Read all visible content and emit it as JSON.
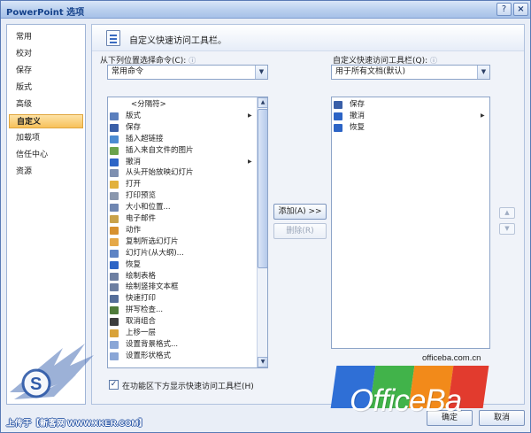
{
  "window": {
    "title": "PowerPoint 选项",
    "help_glyph": "?",
    "close_glyph": "×"
  },
  "sidebar": {
    "items": [
      {
        "label": "常用"
      },
      {
        "label": "校对"
      },
      {
        "label": "保存"
      },
      {
        "label": "版式"
      },
      {
        "label": "高级"
      },
      {
        "label": "自定义",
        "active": true
      },
      {
        "label": "加载项"
      },
      {
        "label": "信任中心"
      },
      {
        "label": "资源"
      }
    ]
  },
  "header": {
    "title": "自定义快速访问工具栏。",
    "icon": "toolbar-icon"
  },
  "left_panel": {
    "choose_label": "从下列位置选择命令(C):",
    "info_glyph": "ⓘ",
    "choose_value": "常用命令",
    "commands": [
      {
        "label": "<分隔符>",
        "icon": "none",
        "separator": true
      },
      {
        "label": "版式",
        "icon": "layout-icon",
        "submenu": true
      },
      {
        "label": "保存",
        "icon": "save-icon"
      },
      {
        "label": "插入超链接",
        "icon": "hyperlink-icon"
      },
      {
        "label": "插入来自文件的图片",
        "icon": "picture-icon"
      },
      {
        "label": "撤消",
        "icon": "undo-icon",
        "submenu": true
      },
      {
        "label": "从头开始放映幻灯片",
        "icon": "slideshow-icon"
      },
      {
        "label": "打开",
        "icon": "open-icon"
      },
      {
        "label": "打印预览",
        "icon": "print-preview-icon"
      },
      {
        "label": "大小和位置...",
        "icon": "size-icon"
      },
      {
        "label": "电子邮件",
        "icon": "email-icon"
      },
      {
        "label": "动作",
        "icon": "action-icon"
      },
      {
        "label": "复制所选幻灯片",
        "icon": "duplicate-slide-icon"
      },
      {
        "label": "幻灯片(从大纲)...",
        "icon": "outline-slides-icon"
      },
      {
        "label": "恢复",
        "icon": "redo-icon"
      },
      {
        "label": "绘制表格",
        "icon": "draw-table-icon"
      },
      {
        "label": "绘制竖排文本框",
        "icon": "vertical-textbox-icon"
      },
      {
        "label": "快速打印",
        "icon": "quick-print-icon"
      },
      {
        "label": "拼写检查...",
        "icon": "spelling-icon"
      },
      {
        "label": "取消组合",
        "icon": "ungroup-icon"
      },
      {
        "label": "上移一层",
        "icon": "bring-forward-icon"
      },
      {
        "label": "设置背景格式...",
        "icon": "background-icon"
      },
      {
        "label": "设置形状格式",
        "icon": "shape-format-icon"
      }
    ]
  },
  "right_panel": {
    "customize_label": "自定义快速访问工具栏(Q):",
    "info_glyph": "ⓘ",
    "customize_value": "用于所有文档(默认)",
    "items": [
      {
        "label": "保存",
        "icon": "save-icon"
      },
      {
        "label": "撤消",
        "icon": "undo-icon",
        "submenu": true
      },
      {
        "label": "恢复",
        "icon": "redo-icon"
      }
    ]
  },
  "buttons": {
    "add": "添加(A) >>",
    "remove": "删除(R)",
    "ok": "确定",
    "cancel": "取消"
  },
  "checkbox": {
    "label": "在功能区下方显示快速访问工具栏(H)",
    "checked": true,
    "mark": "✓"
  },
  "branding": {
    "url": "officeba.com.cn",
    "wordmark": "OfficeBa"
  },
  "watermark": {
    "upload_text": "上传于【新客网 WWW.XKER.COM】"
  },
  "colors": {
    "accent": "#f7c15b",
    "tile_blue": "#2f6fd6",
    "tile_green": "#41b34a",
    "tile_orange": "#f28a1a",
    "tile_red": "#e23b2e"
  }
}
